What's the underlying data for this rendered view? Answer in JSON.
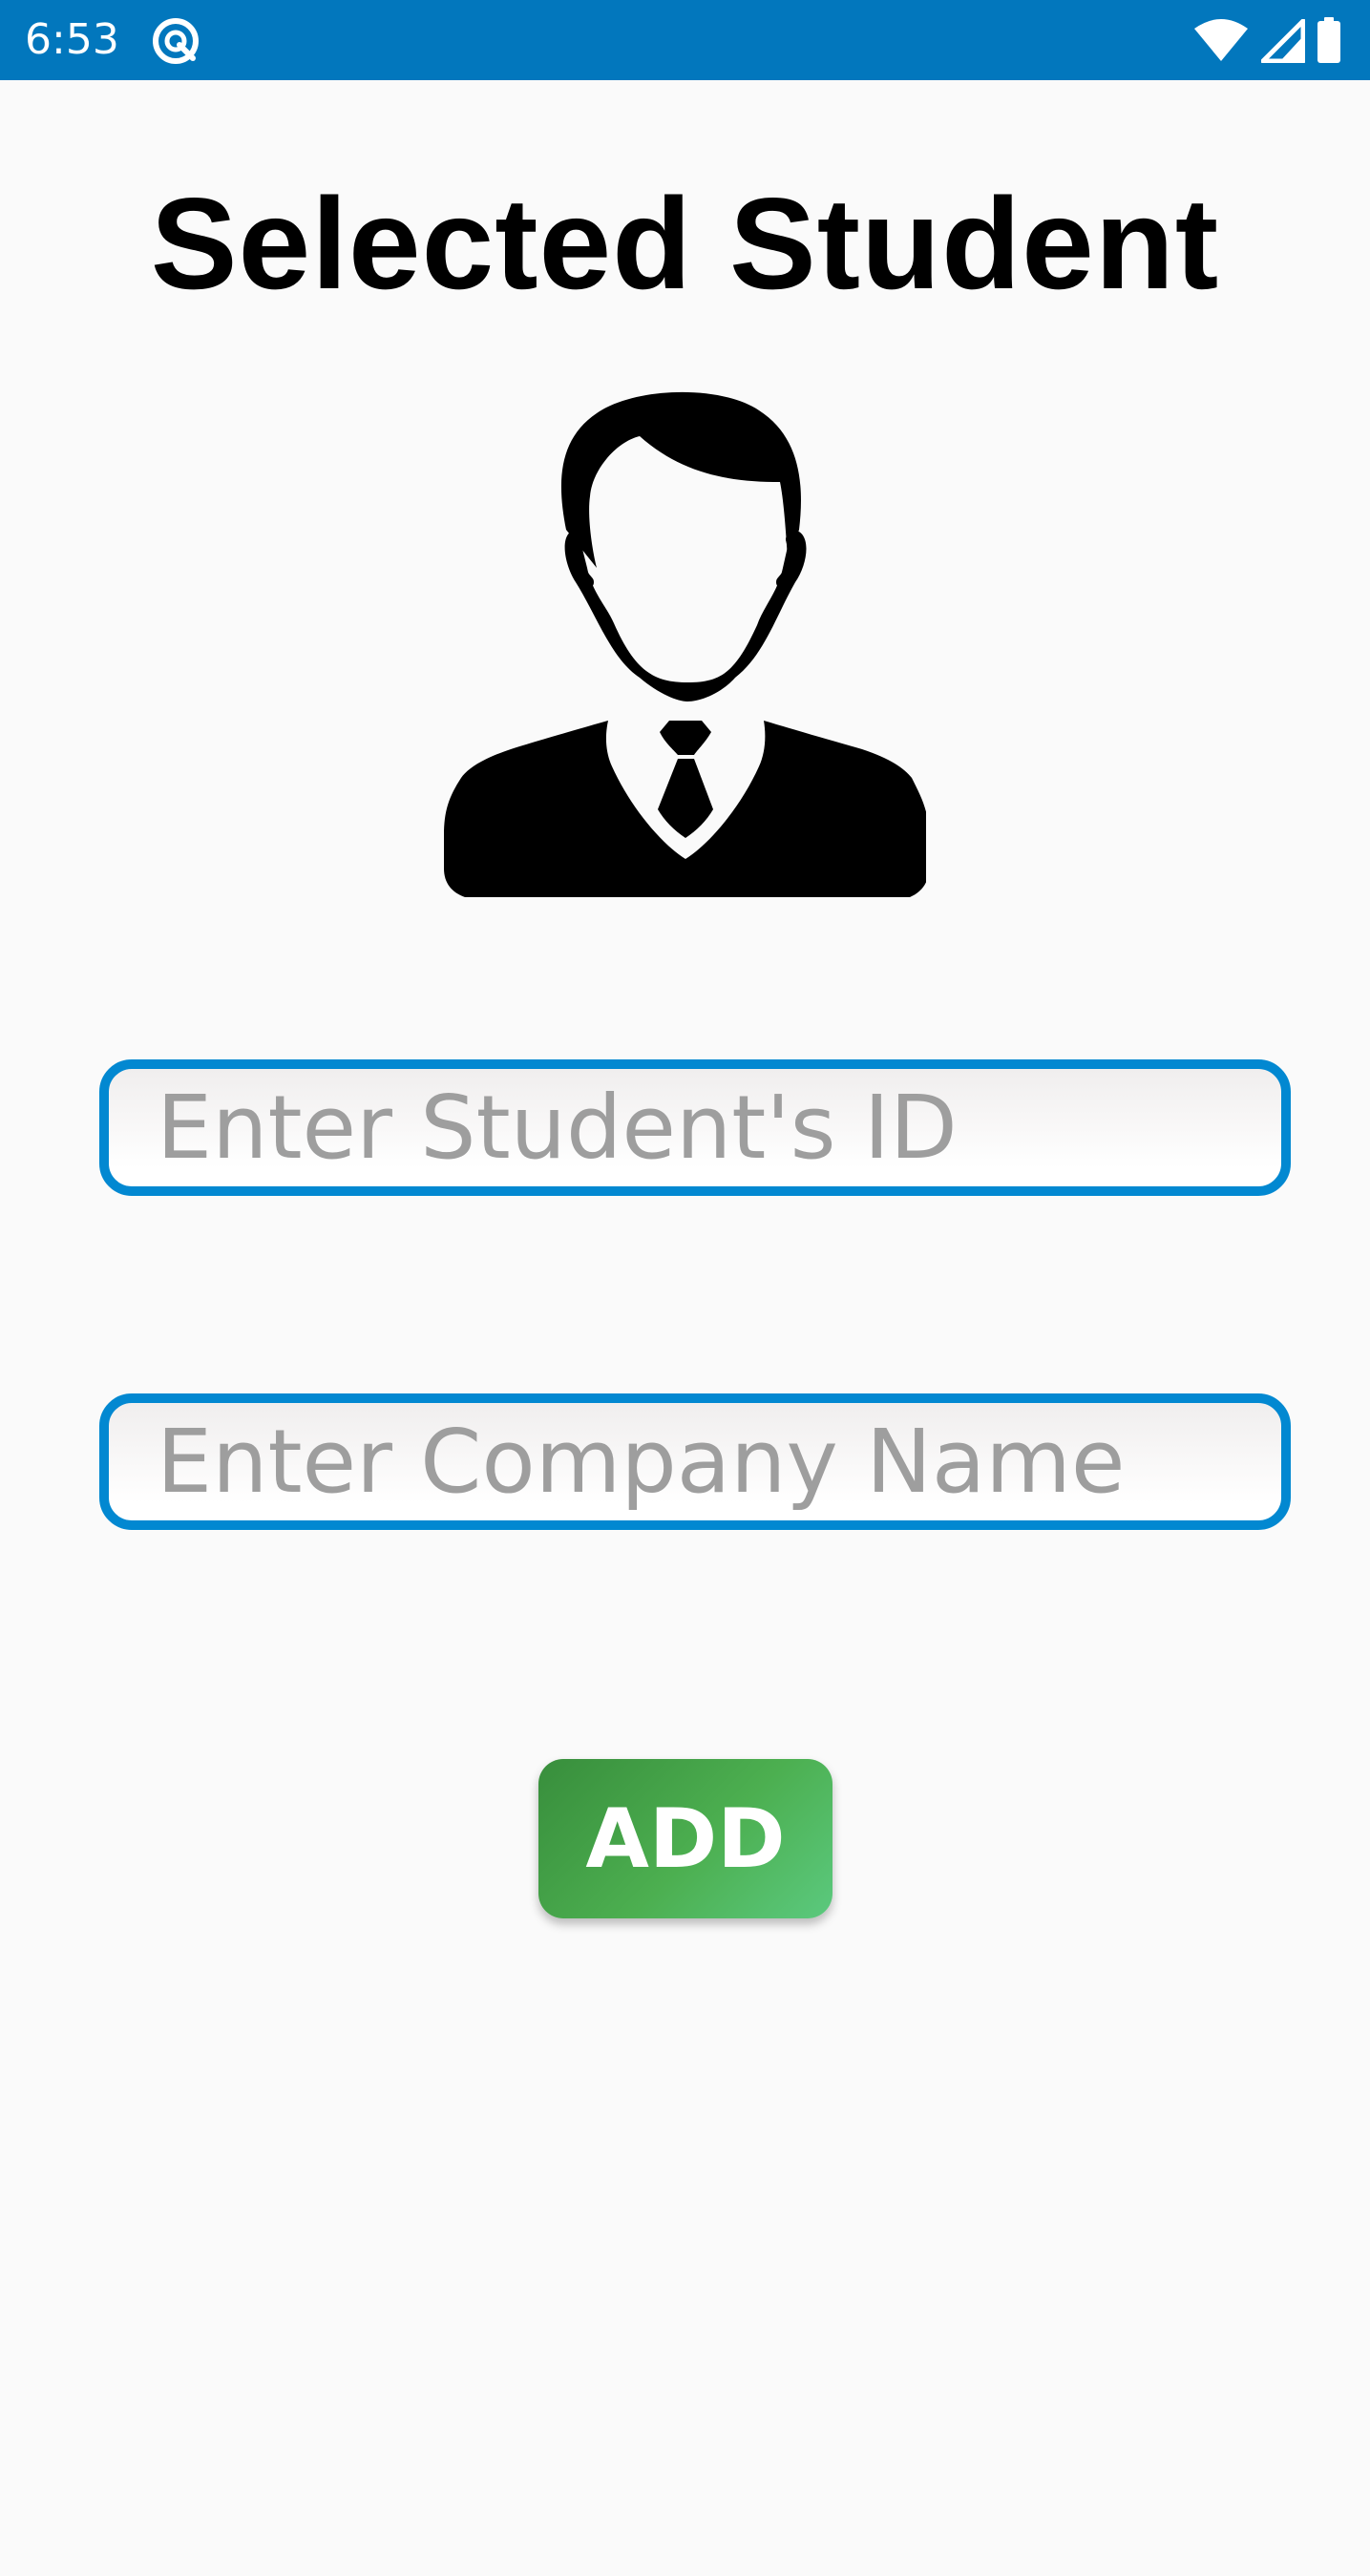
{
  "status_bar": {
    "time": "6:53",
    "app_icon": "circular-q-icon",
    "icons": [
      "wifi-icon",
      "cellular-signal-icon",
      "battery-icon"
    ],
    "background_color": "#0277bd"
  },
  "page": {
    "title": "Selected Student",
    "avatar_icon": "student-avatar-icon"
  },
  "form": {
    "student_id": {
      "value": "",
      "placeholder": "Enter Student's ID"
    },
    "company_name": {
      "value": "",
      "placeholder": "Enter Company Name"
    },
    "field_border_color": "#0288d1",
    "add_label": "ADD",
    "add_button_color": "#4caf50"
  }
}
